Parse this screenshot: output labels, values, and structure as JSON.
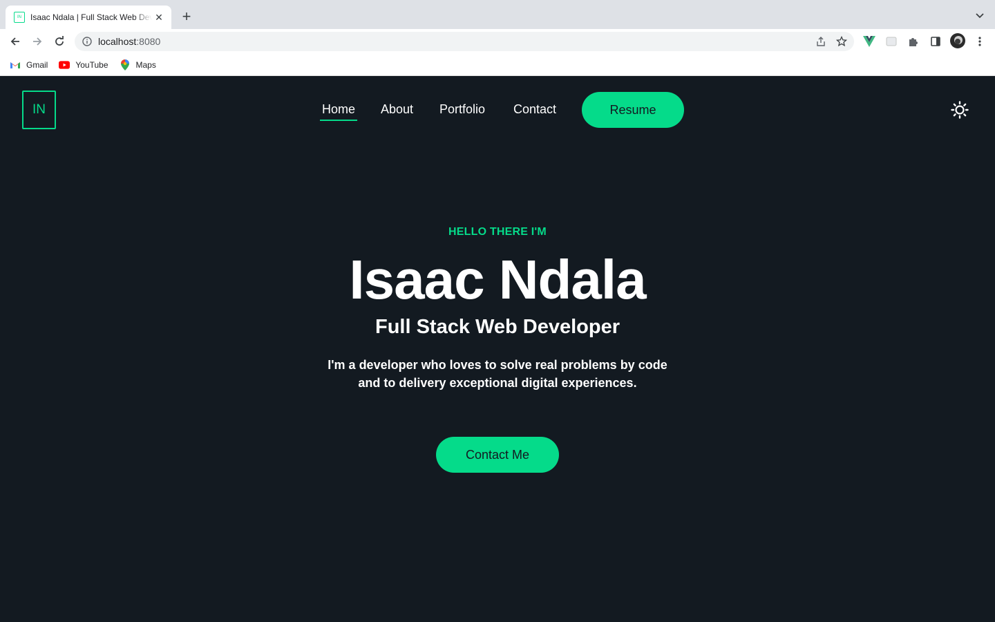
{
  "browser": {
    "tab": {
      "title": "Isaac Ndala | Full Stack Web Developer",
      "favicon_text": "IN"
    },
    "address": {
      "host": "localhost",
      "port": ":8080"
    },
    "bookmarks": [
      {
        "label": "Gmail",
        "icon": "gmail-icon"
      },
      {
        "label": "YouTube",
        "icon": "youtube-icon"
      },
      {
        "label": "Maps",
        "icon": "maps-icon"
      }
    ]
  },
  "site": {
    "logo_text": "IN",
    "nav": {
      "items": [
        "Home",
        "About",
        "Portfolio",
        "Contact"
      ],
      "active": "Home",
      "resume_label": "Resume"
    },
    "hero": {
      "eyebrow": "HELLO THERE I'M",
      "name": "Isaac Ndala",
      "role": "Full Stack Web Developer",
      "description": "I'm a developer who loves to solve real problems by code and to delivery exceptional digital experiences.",
      "cta_label": "Contact Me"
    }
  },
  "colors": {
    "accent": "#05db8a",
    "background": "#131a21",
    "text": "#ffffff"
  }
}
